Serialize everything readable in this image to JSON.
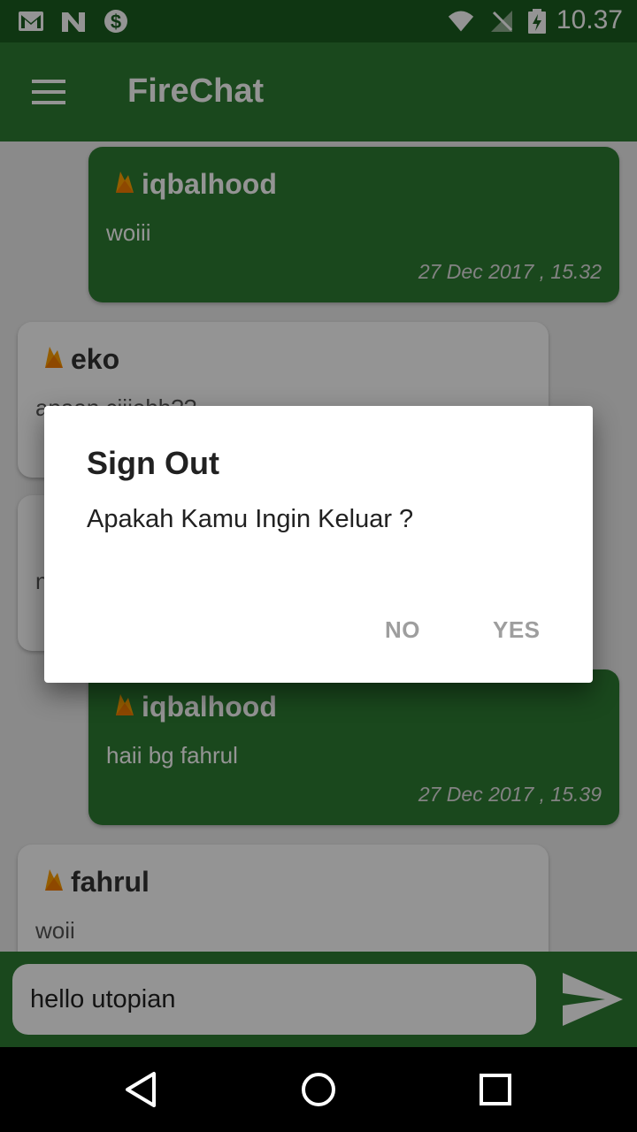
{
  "status_bar": {
    "time": "10.37",
    "icons": [
      "gmail-icon",
      "n-icon",
      "dollar-icon",
      "wifi-icon",
      "no-signal-icon",
      "battery-charging-icon"
    ]
  },
  "app_bar": {
    "title": "FireChat",
    "menu_icon": "hamburger-menu-icon"
  },
  "messages": [
    {
      "sender": "iqbalhood",
      "text": "woiii",
      "timestamp": "27 Dec 2017 , 15.32",
      "type": "sent"
    },
    {
      "sender": "eko",
      "text": "apaan ciiiehh??",
      "timestamp": "",
      "type": "received"
    },
    {
      "sender": "",
      "text": "n",
      "timestamp": "",
      "type": "received"
    },
    {
      "sender": "iqbalhood",
      "text": "haii bg fahrul",
      "timestamp": "27 Dec 2017 , 15.39",
      "type": "sent"
    },
    {
      "sender": "fahrul",
      "text": "woii",
      "timestamp": "",
      "type": "received"
    }
  ],
  "input": {
    "value": "hello utopian",
    "send_icon": "send-icon"
  },
  "dialog": {
    "title": "Sign Out",
    "message": "Apakah Kamu Ingin Keluar ?",
    "negative": "NO",
    "positive": "YES"
  },
  "nav_bar": {
    "icons": [
      "back-icon",
      "home-icon",
      "recents-icon"
    ]
  },
  "colors": {
    "primary": "#2e7d32",
    "primary_dark": "#1b5e20",
    "dialog_button": "#9e9e9e"
  }
}
